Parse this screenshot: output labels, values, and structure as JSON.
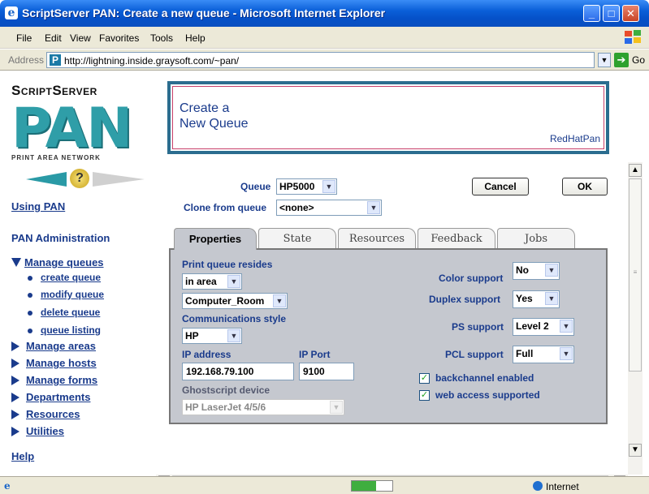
{
  "window": {
    "title": "ScriptServer PAN: Create a new queue - Microsoft Internet Explorer"
  },
  "menu": [
    "File",
    "Edit",
    "View",
    "Favorites",
    "Tools",
    "Help"
  ],
  "address": {
    "label": "Address",
    "url": "http://lightning.inside.graysoft.com/~pan/",
    "go": "Go"
  },
  "logo": {
    "line1": "ScriptServer",
    "line2": "PAN",
    "line3": "PRINT AREA NETWORK"
  },
  "sidebar": {
    "using_pan": "Using PAN",
    "admin": "PAN Administration",
    "manage_queues": "Manage queues",
    "queue_sub": [
      "create queue",
      "modify queue",
      "delete queue",
      "queue listing"
    ],
    "sections": [
      "Manage areas",
      "Manage hosts",
      "Manage forms",
      "Departments",
      "Resources",
      "Utilities"
    ],
    "help": "Help"
  },
  "banner": {
    "title_line1": "Create a",
    "title_line2": "New Queue",
    "user": "RedHatPan"
  },
  "form": {
    "queue_label": "Queue",
    "queue_value": "HP5000",
    "clone_label": "Clone from queue",
    "clone_value": "<none>",
    "cancel": "Cancel",
    "ok": "OK"
  },
  "tabs": [
    "Properties",
    "State",
    "Resources",
    "Feedback",
    "Jobs"
  ],
  "props": {
    "resides_label": "Print queue resides",
    "resides_value": "in area",
    "area_value": "Computer_Room",
    "comm_label": "Communications style",
    "comm_value": "HP",
    "ip_label": "IP address",
    "ip_value": "192.168.79.100",
    "port_label": "IP Port",
    "port_value": "9100",
    "gs_label": "Ghostscript device",
    "gs_value": "HP LaserJet 4/5/6",
    "color_label": "Color support",
    "color_value": "No",
    "duplex_label": "Duplex support",
    "duplex_value": "Yes",
    "ps_label": "PS support",
    "ps_value": "Level 2",
    "pcl_label": "PCL support",
    "pcl_value": "Full",
    "backchannel": "backchannel enabled",
    "webaccess": "web access supported"
  },
  "status": {
    "zone": "Internet"
  }
}
